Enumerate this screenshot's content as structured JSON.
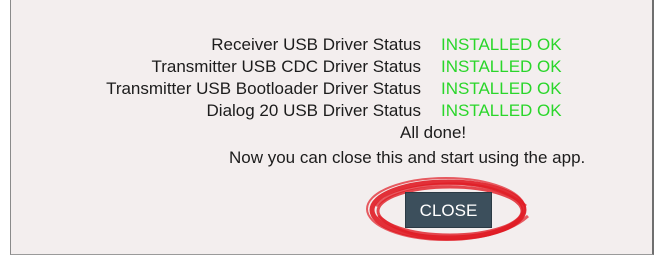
{
  "rows": [
    {
      "label": "Receiver USB Driver Status",
      "status": "INSTALLED OK"
    },
    {
      "label": "Transmitter USB CDC Driver Status",
      "status": "INSTALLED OK"
    },
    {
      "label": "Transmitter USB Bootloader Driver Status",
      "status": "INSTALLED OK"
    },
    {
      "label": "Dialog 20 USB Driver Status",
      "status": "INSTALLED OK"
    }
  ],
  "done_text": "All done!",
  "message": "Now you can close this and start using the app.",
  "close_label": "CLOSE",
  "colors": {
    "status_ok": "#2ad62a",
    "button_bg": "#3c4f5c",
    "highlight": "#e01b24",
    "dialog_bg": "#f3eeee"
  }
}
